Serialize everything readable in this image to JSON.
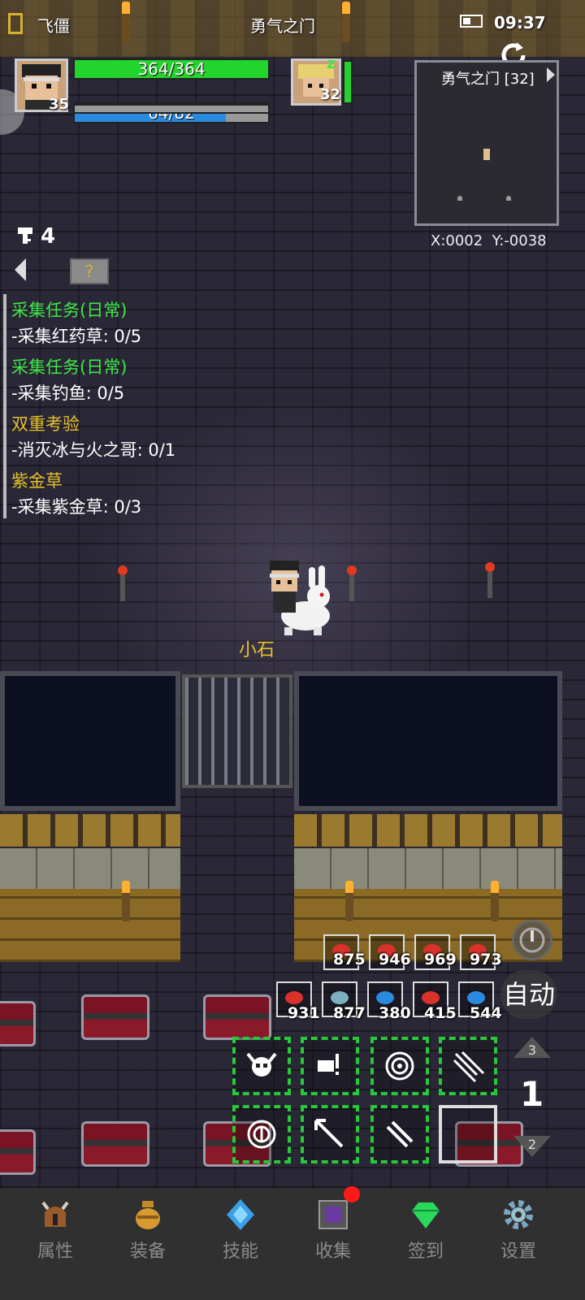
{
  "status_bar": {
    "location_left": "飞僵",
    "map_name": "勇气之门",
    "time": "09:37"
  },
  "player": {
    "level": "35",
    "hp": "364/364",
    "mp": "64/82",
    "hp_fraction": 1.0,
    "mp_fraction": 0.78
  },
  "companion": {
    "level": "32"
  },
  "minimap": {
    "title": "勇气之门 [32]",
    "coords": "X:0002  Y:-0038"
  },
  "key_count": "4",
  "quests": [
    {
      "title": "采集任务(日常)",
      "detail": "-采集红药草: 0/5",
      "color": "green"
    },
    {
      "title": "采集任务(日常)",
      "detail": "-采集钓鱼: 0/5",
      "color": "green"
    },
    {
      "title": "双重考验",
      "detail": "-消灭冰与火之哥: 0/1",
      "color": "gold"
    },
    {
      "title": "紫金草",
      "detail": "-采集紫金草: 0/3",
      "color": "gold"
    }
  ],
  "npc_name": "小石",
  "potions_row1": [
    {
      "count": "875",
      "color": "#d8322a"
    },
    {
      "count": "946",
      "color": "#d8322a"
    },
    {
      "count": "969",
      "color": "#d8322a"
    },
    {
      "count": "973",
      "color": "#d8322a"
    }
  ],
  "potions_row2": [
    {
      "count": "931",
      "color": "#d8322a"
    },
    {
      "count": "877",
      "color": "#7ab0c0"
    },
    {
      "count": "380",
      "color": "#2a8ae0"
    },
    {
      "count": "415",
      "color": "#d8322a"
    },
    {
      "count": "544",
      "color": "#2a8ae0"
    }
  ],
  "auto_label": "自动",
  "page_up": "3",
  "page_current": "1",
  "page_down": "2",
  "nav": {
    "attributes": "属性",
    "equipment": "装备",
    "skills": "技能",
    "collection": "收集",
    "checkin": "签到",
    "settings": "设置"
  }
}
